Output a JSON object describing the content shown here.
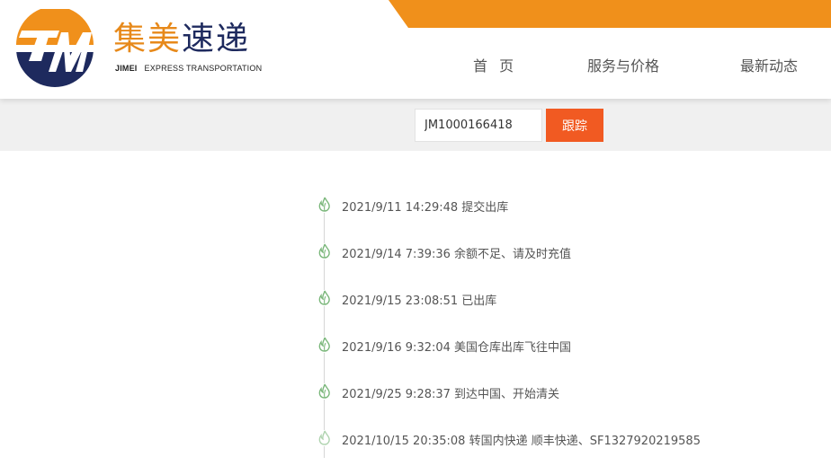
{
  "brand": {
    "name_cn": [
      "集",
      "美",
      "速",
      "递"
    ],
    "name_en_1": "JIMEI",
    "name_en_2": "EXPRESS TRANSPORTATION",
    "logo_icon": "tm-logo-icon",
    "accent_orange": "#f0901b",
    "accent_navy": "#1e2a5e"
  },
  "nav": {
    "home": "首 页",
    "service": "服务与价格",
    "news": "最新动态"
  },
  "search": {
    "tracking_number": "JM1000166418",
    "button_label": "跟踪",
    "button_color": "#f15a22"
  },
  "timeline": {
    "icon": "leaf-icon",
    "events": [
      {
        "text": "2021/9/11 14:29:48 提交出库"
      },
      {
        "text": "2021/9/14 7:39:36 余额不足、请及时充值"
      },
      {
        "text": "2021/9/15 23:08:51 已出库"
      },
      {
        "text": "2021/9/16 9:32:04 美国仓库出库飞往中国"
      },
      {
        "text": "2021/9/25 9:28:37 到达中国、开始清关"
      },
      {
        "text": "2021/10/15 20:35:08 转国内快递 顺丰快递、SF1327920219585"
      }
    ]
  }
}
